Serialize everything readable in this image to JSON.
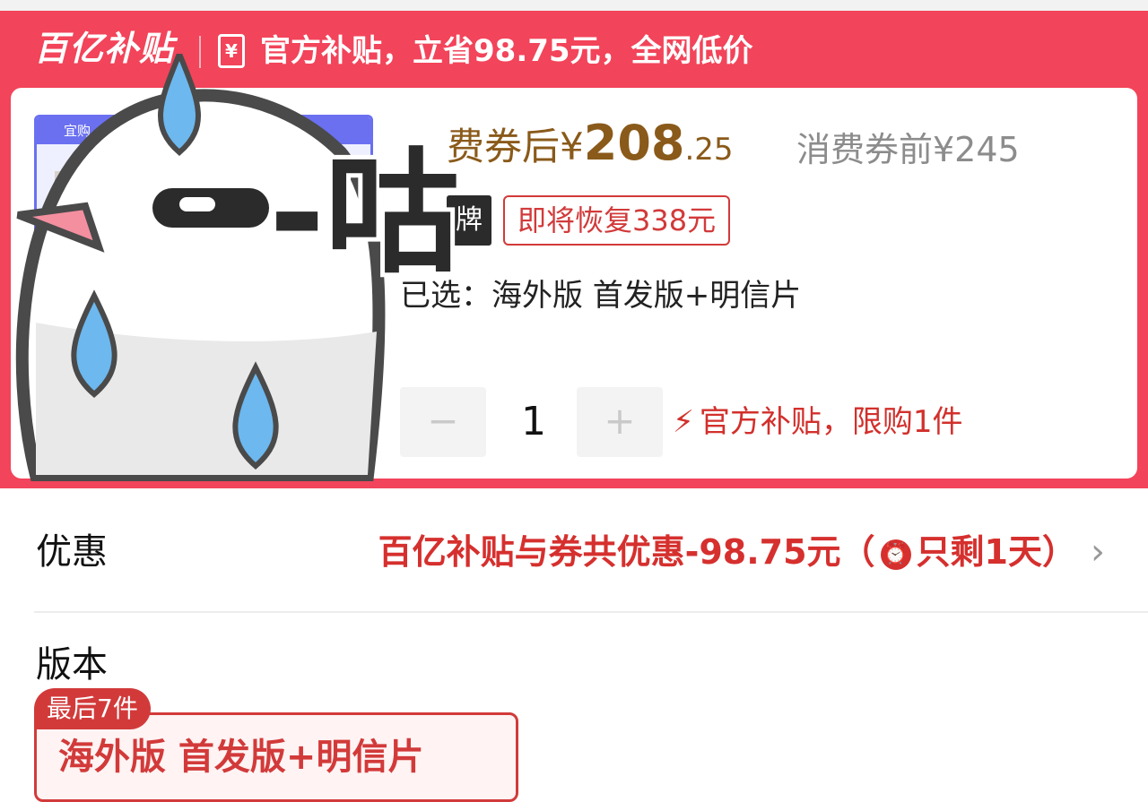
{
  "banner": {
    "logo": "百亿补贴",
    "coupon_icon": "¥",
    "text": "官方补贴，立省98.75元，全网低价"
  },
  "product": {
    "thumb_label": "宜购",
    "sticker_text": "-咕",
    "price_prefix": "费券后",
    "price_yen": "¥",
    "price_int": "208",
    "price_dec": ".25",
    "price_before": "消费券前¥245",
    "brand_tag": "牌",
    "restore_tag": "即将恢复338元",
    "selected": "已选：海外版 首发版+明信片",
    "qty_minus": "−",
    "qty_value": "1",
    "qty_plus": "+",
    "limit_icon": "⚡",
    "limit_text": "官方补贴，限购1件"
  },
  "promo": {
    "label": "优惠",
    "value_main": "百亿补贴与券共优惠-98.75元（",
    "alarm_icon": "⏰",
    "value_tail": "只剩1天）",
    "chevron": "›"
  },
  "version": {
    "label": "版本",
    "stock_badge": "最后7件",
    "option": "海外版 首发版+明信片"
  },
  "colors": {
    "brand_red": "#f2445a",
    "price_brown": "#8a5a1a",
    "alert_red": "#d5302e"
  }
}
